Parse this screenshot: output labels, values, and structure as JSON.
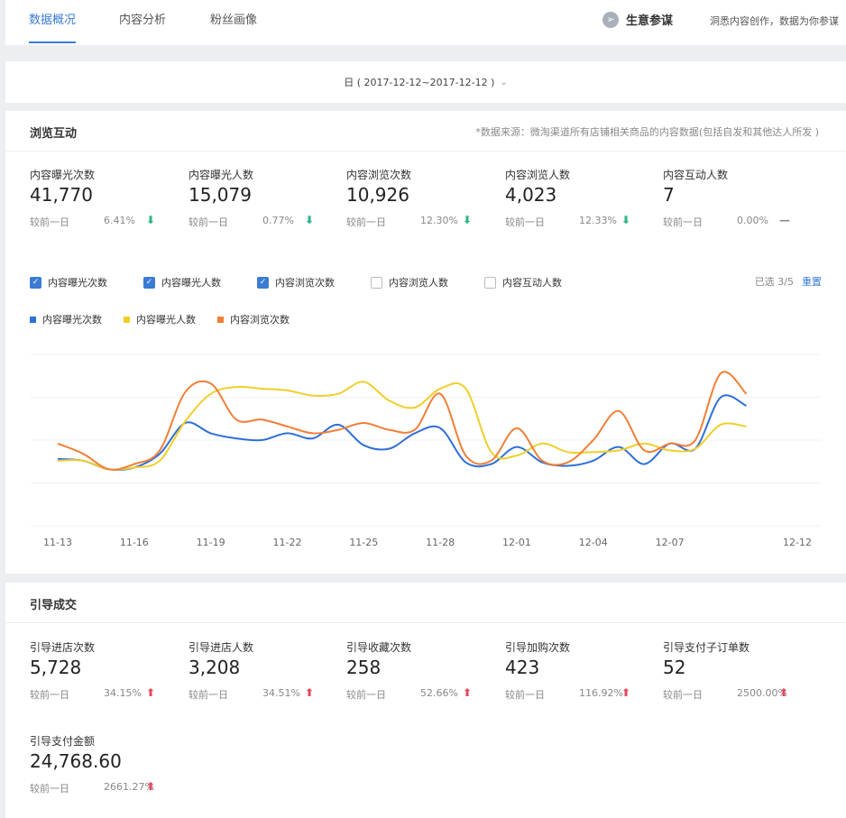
{
  "tabs": [
    {
      "label": "数据概况",
      "active": true
    },
    {
      "label": "内容分析",
      "active": false
    },
    {
      "label": "粉丝画像",
      "active": false
    }
  ],
  "brand": {
    "icon": "compass-icon",
    "name": "生意参谋",
    "slogan": "洞悉内容创作，数据为你参谋"
  },
  "date": {
    "label": "日 ( 2017-12-12~2017-12-12 )",
    "icon": "chevron-down-icon"
  },
  "browse": {
    "title": "浏览互动",
    "note": "*数据来源：微淘渠道所有店铺相关商品的内容数据(包括自发和其他达人所发 )",
    "metrics": [
      {
        "label": "内容曝光次数",
        "value": "41,770",
        "cmp_label": "较前一日",
        "pct": "6.41%",
        "dir": "down"
      },
      {
        "label": "内容曝光人数",
        "value": "15,079",
        "cmp_label": "较前一日",
        "pct": "0.77%",
        "dir": "down"
      },
      {
        "label": "内容浏览次数",
        "value": "10,926",
        "cmp_label": "较前一日",
        "pct": "12.30%",
        "dir": "down"
      },
      {
        "label": "内容浏览人数",
        "value": "4,023",
        "cmp_label": "较前一日",
        "pct": "12.33%",
        "dir": "down"
      },
      {
        "label": "内容互动人数",
        "value": "7",
        "cmp_label": "较前一日",
        "pct": "0.00%",
        "dir": "flat"
      }
    ],
    "filters": [
      {
        "label": "内容曝光次数",
        "checked": true
      },
      {
        "label": "内容曝光人数",
        "checked": true
      },
      {
        "label": "内容浏览次数",
        "checked": true
      },
      {
        "label": "内容浏览人数",
        "checked": false
      },
      {
        "label": "内容互动人数",
        "checked": false
      }
    ],
    "selected_text": "已选 3/5",
    "reset_label": "重置"
  },
  "chart_data": {
    "type": "line",
    "x": [
      "11-13",
      "11-14",
      "11-15",
      "11-16",
      "11-17",
      "11-18",
      "11-19",
      "11-20",
      "11-21",
      "11-22",
      "11-23",
      "11-24",
      "11-25",
      "11-26",
      "11-27",
      "11-28",
      "11-29",
      "11-30",
      "12-01",
      "12-02",
      "12-03",
      "12-04",
      "12-05",
      "12-06",
      "12-07",
      "12-08",
      "12-09",
      "12-10",
      "12-11",
      "12-12"
    ],
    "tick_labels": [
      "11-13",
      "11-16",
      "11-19",
      "11-22",
      "11-25",
      "11-28",
      "12-01",
      "12-04",
      "12-07",
      "12-12"
    ],
    "tick_positions": [
      0,
      3,
      6,
      9,
      12,
      15,
      18,
      21,
      24,
      29
    ],
    "ylim": [
      0,
      100
    ],
    "grid": true,
    "legend_position": "top-left",
    "series": [
      {
        "name": "内容曝光次数",
        "color": "#2f6fd8",
        "values": [
          39,
          38,
          33,
          34,
          42,
          60,
          54,
          51,
          50,
          54,
          51,
          59,
          47,
          45,
          54,
          57,
          37,
          36,
          46,
          37,
          35,
          38,
          46,
          36,
          48,
          45,
          75,
          70
        ]
      },
      {
        "name": "内容曝光人数",
        "color": "#f0cf2a",
        "values": [
          38,
          38,
          33,
          34,
          38,
          61,
          77,
          81,
          80,
          79,
          76,
          77,
          84,
          73,
          69,
          80,
          80,
          43,
          41,
          48,
          43,
          43,
          44,
          48,
          44,
          45,
          59,
          58
        ]
      },
      {
        "name": "内容浏览次数",
        "color": "#f07f37",
        "values": [
          48,
          42,
          33,
          36,
          44,
          78,
          83,
          62,
          62,
          58,
          54,
          56,
          60,
          56,
          56,
          77,
          41,
          38,
          57,
          38,
          37,
          50,
          67,
          44,
          48,
          50,
          89,
          77
        ]
      }
    ]
  },
  "guide": {
    "title": "引导成交",
    "metrics": [
      {
        "label": "引导进店次数",
        "value": "5,728",
        "cmp_label": "较前一日",
        "pct": "34.15%",
        "dir": "up"
      },
      {
        "label": "引导进店人数",
        "value": "3,208",
        "cmp_label": "较前一日",
        "pct": "34.51%",
        "dir": "up"
      },
      {
        "label": "引导收藏次数",
        "value": "258",
        "cmp_label": "较前一日",
        "pct": "52.66%",
        "dir": "up"
      },
      {
        "label": "引导加购次数",
        "value": "423",
        "cmp_label": "较前一日",
        "pct": "116.92%",
        "dir": "up"
      },
      {
        "label": "引导支付子订单数",
        "value": "52",
        "cmp_label": "较前一日",
        "pct": "2500.00%",
        "dir": "up"
      },
      {
        "label": "引导支付金额",
        "value": "24,768.60",
        "cmp_label": "较前一日",
        "pct": "2661.27%",
        "dir": "up"
      }
    ]
  }
}
